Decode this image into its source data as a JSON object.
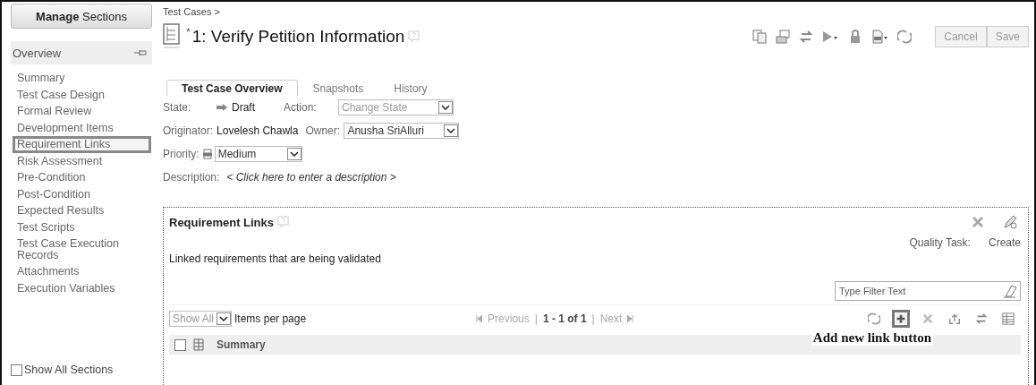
{
  "sidebar": {
    "manage_button": "**Manage** Sections",
    "header": "Overview",
    "items": [
      {
        "label": "Summary",
        "selected": false
      },
      {
        "label": "Test Case Design",
        "selected": false
      },
      {
        "label": "Formal Review",
        "selected": false
      },
      {
        "label": "Development Items",
        "selected": false
      },
      {
        "label": "Requirement Links",
        "selected": true
      },
      {
        "label": "Risk Assessment",
        "selected": false
      },
      {
        "label": "Pre-Condition",
        "selected": false
      },
      {
        "label": "Post-Condition",
        "selected": false
      },
      {
        "label": "Expected Results",
        "selected": false
      },
      {
        "label": "Test Scripts",
        "selected": false
      },
      {
        "label": "Test Case Execution Records",
        "selected": false
      },
      {
        "label": "Attachments",
        "selected": false
      },
      {
        "label": "Execution Variables",
        "selected": false
      }
    ],
    "show_all": {
      "label": "Show All Sections",
      "checked": false
    }
  },
  "breadcrumb": "Test Cases >",
  "title": {
    "marker": "*",
    "text": "1: Verify Petition Information"
  },
  "toolbar": {
    "buttons": [
      "Cancel",
      "Save"
    ]
  },
  "tabs": [
    {
      "label": "Test Case Overview",
      "selected": true
    },
    {
      "label": "Snapshots",
      "selected": false
    },
    {
      "label": "History",
      "selected": false
    }
  ],
  "fields": {
    "state_label": "State:",
    "state_value": "Draft",
    "action_label": "Action:",
    "action_value": "Change State",
    "originator_label": "Originator:",
    "originator_value": "Lovelesh Chawla",
    "owner_label": "Owner:",
    "owner_value": "Anusha SriAlluri",
    "priority_label": "Priority:",
    "priority_value": "Medium",
    "description_label": "Description:",
    "description_value": "< Click here to enter a description >"
  },
  "panel": {
    "title": "Requirement Links",
    "quality_label": "Quality Task:",
    "quality_action": "Create",
    "description": "Linked requirements that are being validated",
    "filter_placeholder": "Type Filter Text",
    "page_size": "Show All",
    "page_size_label": "Items per page",
    "pager": {
      "previous": "Previous",
      "separator_1": "|",
      "range": "1 - 1 of 1",
      "separator_2": "|",
      "next": "Next"
    },
    "actions": [
      {
        "kind": "sync",
        "selected": false
      },
      {
        "kind": "add",
        "selected": true
      },
      {
        "kind": "delete",
        "selected": false
      },
      {
        "kind": "export",
        "selected": false
      },
      {
        "kind": "swap",
        "selected": false
      },
      {
        "kind": "columns",
        "selected": false
      }
    ],
    "select_all_checked": false,
    "columns": [
      "Summary"
    ],
    "annotation": "Add new link button"
  }
}
